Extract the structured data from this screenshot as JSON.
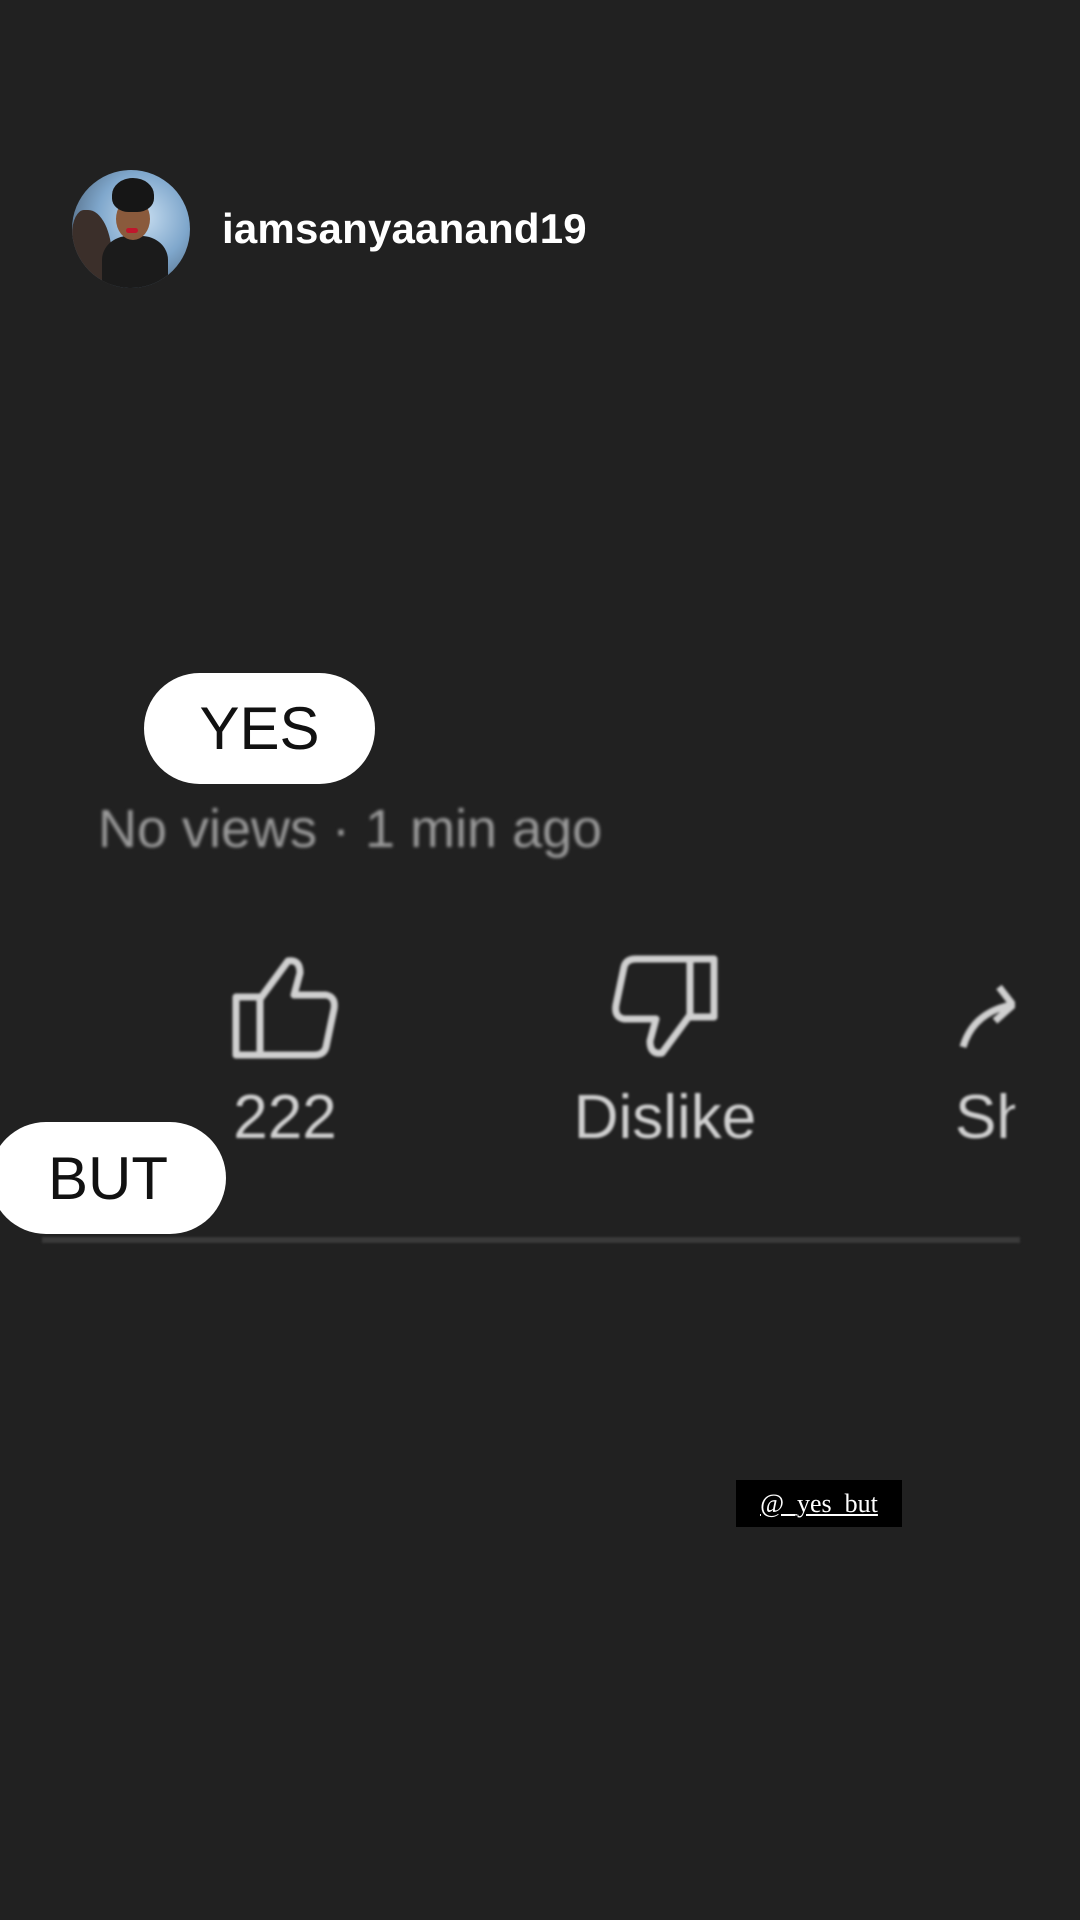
{
  "header": {
    "username": "iamsanyaanand19",
    "avatar_icon": "profile-photo"
  },
  "captions": {
    "yes": "YES",
    "but": "BUT"
  },
  "video": {
    "meta": "No views · 1 min ago",
    "actions": {
      "like_count": "222",
      "dislike_label": "Dislike",
      "share_label": "Sh"
    }
  },
  "watermark": "@_yes_but",
  "colors": {
    "background": "#212121",
    "pill": "#ffffff",
    "muted_text": "#9a9a9a"
  }
}
